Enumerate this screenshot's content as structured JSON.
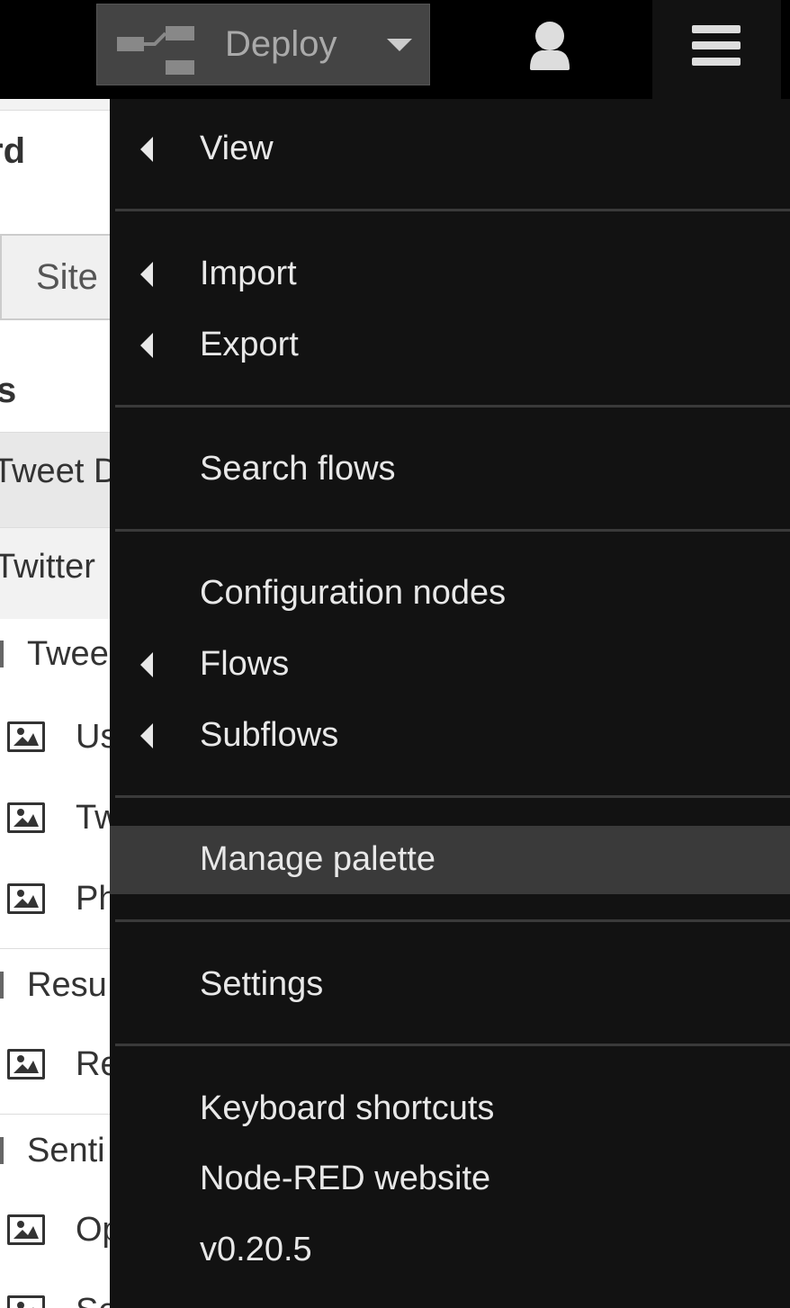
{
  "header": {
    "deploy_label": "Deploy"
  },
  "sidebar": {
    "title_fragment": "rd",
    "tab_label": "Site",
    "section_fragment": "s",
    "rows": [
      {
        "label": "Tweet D"
      },
      {
        "label": "Twitter"
      }
    ],
    "groups": [
      {
        "label": "Twee",
        "items": [
          "Us",
          "Tw",
          "Ph"
        ]
      },
      {
        "label": "Resu",
        "items": [
          "Re"
        ]
      },
      {
        "label": "Senti",
        "items": [
          "Op",
          "Sentiment Score"
        ]
      }
    ]
  },
  "menu": {
    "view": "View",
    "import": "Import",
    "export": "Export",
    "search_flows": "Search flows",
    "configuration_nodes": "Configuration nodes",
    "flows": "Flows",
    "subflows": "Subflows",
    "manage_palette": "Manage palette",
    "settings": "Settings",
    "keyboard_shortcuts": "Keyboard shortcuts",
    "website": "Node-RED website",
    "version": "v0.20.5"
  },
  "icons": {
    "deploy": "deploy-flow-icon",
    "user": "user-icon",
    "menu": "hamburger-menu-icon",
    "submenu": "caret-left-icon",
    "image": "image-icon"
  }
}
